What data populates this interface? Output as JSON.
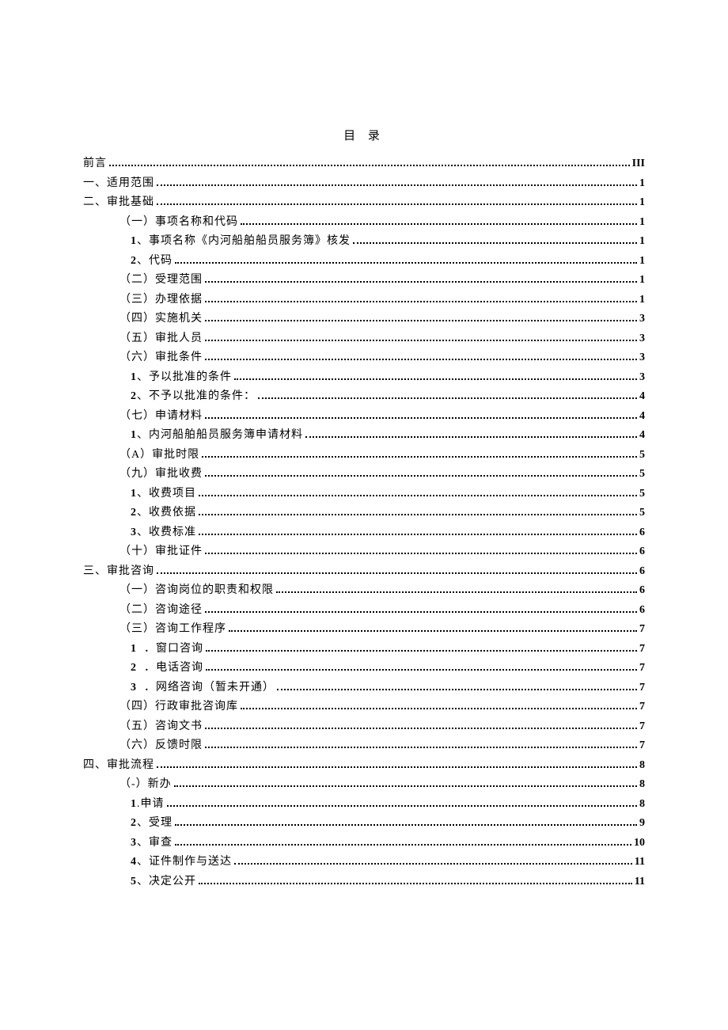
{
  "title": "目 录",
  "toc": [
    {
      "level": 0,
      "label": "前言",
      "page": "III"
    },
    {
      "level": 0,
      "label": "一、适用范围",
      "page": "1"
    },
    {
      "level": 0,
      "label": "二、审批基础",
      "page": "1"
    },
    {
      "level": 1,
      "label": "（一）事项名称和代码",
      "page": "1"
    },
    {
      "level": 2,
      "num": "1",
      "sep": "、",
      "text": "事项名称《内河船舶船员服务簿》核发",
      "page": "1"
    },
    {
      "level": 2,
      "num": "2",
      "sep": "、",
      "text": "代码",
      "page": "1"
    },
    {
      "level": 1,
      "label": "（二）受理范围",
      "page": "1"
    },
    {
      "level": 1,
      "label": "（三）办理依据",
      "page": "1"
    },
    {
      "level": 1,
      "label": "（四）实施机关",
      "page": "3"
    },
    {
      "level": 1,
      "label": "（五）审批人员",
      "page": "3"
    },
    {
      "level": 1,
      "label": "（六）审批条件",
      "page": "3"
    },
    {
      "level": 2,
      "num": "1",
      "sep": "、",
      "text": "予以批准的条件",
      "page": "3"
    },
    {
      "level": 2,
      "num": "2",
      "sep": "、",
      "text": "不予以批准的条件：",
      "page": "4"
    },
    {
      "level": 1,
      "label": "（七）申请材料",
      "page": "4"
    },
    {
      "level": 2,
      "num": "1",
      "sep": "、",
      "text": "内河船舶船员服务簿申请材料",
      "page": "4"
    },
    {
      "level": 1,
      "label": "（A）审批时限",
      "page": "5"
    },
    {
      "level": 1,
      "label": "（九）审批收费",
      "page": "5"
    },
    {
      "level": 2,
      "num": "1",
      "sep": "、",
      "text": "收费项目",
      "page": "5"
    },
    {
      "level": 2,
      "num": "2",
      "sep": "、",
      "text": "收费依据",
      "page": "5"
    },
    {
      "level": 2,
      "num": "3",
      "sep": "、",
      "text": "收费标准",
      "page": "6"
    },
    {
      "level": 1,
      "label": "（十）审批证件",
      "page": "6"
    },
    {
      "level": 0,
      "label": "三、审批咨询",
      "page": "6"
    },
    {
      "level": 1,
      "label": "（一）咨询岗位的职责和权限",
      "page": "6"
    },
    {
      "level": 1,
      "label": "（二）咨询途径",
      "page": "6"
    },
    {
      "level": 1,
      "label": "（三）咨询工作程序",
      "page": "7"
    },
    {
      "level": 2,
      "num": "1",
      "sep": "．",
      "text": "窗口咨询",
      "page": "7",
      "spaced": true
    },
    {
      "level": 2,
      "num": "2",
      "sep": "．",
      "text": "电话咨询",
      "page": "7",
      "spaced": true
    },
    {
      "level": 2,
      "num": "3",
      "sep": "．",
      "text": "网络咨询（暂未开通）",
      "page": "7",
      "spaced": true
    },
    {
      "level": 1,
      "label": "（四）行政审批咨询库",
      "page": "7"
    },
    {
      "level": 1,
      "label": "（五）咨询文书",
      "page": "7"
    },
    {
      "level": 1,
      "label": "（六）反馈时限",
      "page": "7"
    },
    {
      "level": 0,
      "label": "四、审批流程",
      "page": "8"
    },
    {
      "level": 1,
      "label": "（-）新办",
      "page": "8"
    },
    {
      "level": 2,
      "num": "1",
      "sep": ".",
      "text": "申请",
      "page": "8"
    },
    {
      "level": 2,
      "num": "2",
      "sep": "、",
      "text": "受理",
      "page": "9"
    },
    {
      "level": 2,
      "num": "3",
      "sep": "、",
      "text": "审查",
      "page": "10"
    },
    {
      "level": 2,
      "num": "4",
      "sep": "、",
      "text": "证件制作与送达",
      "page": "11"
    },
    {
      "level": 2,
      "num": "5",
      "sep": "、",
      "text": "决定公开",
      "page": "11"
    }
  ]
}
